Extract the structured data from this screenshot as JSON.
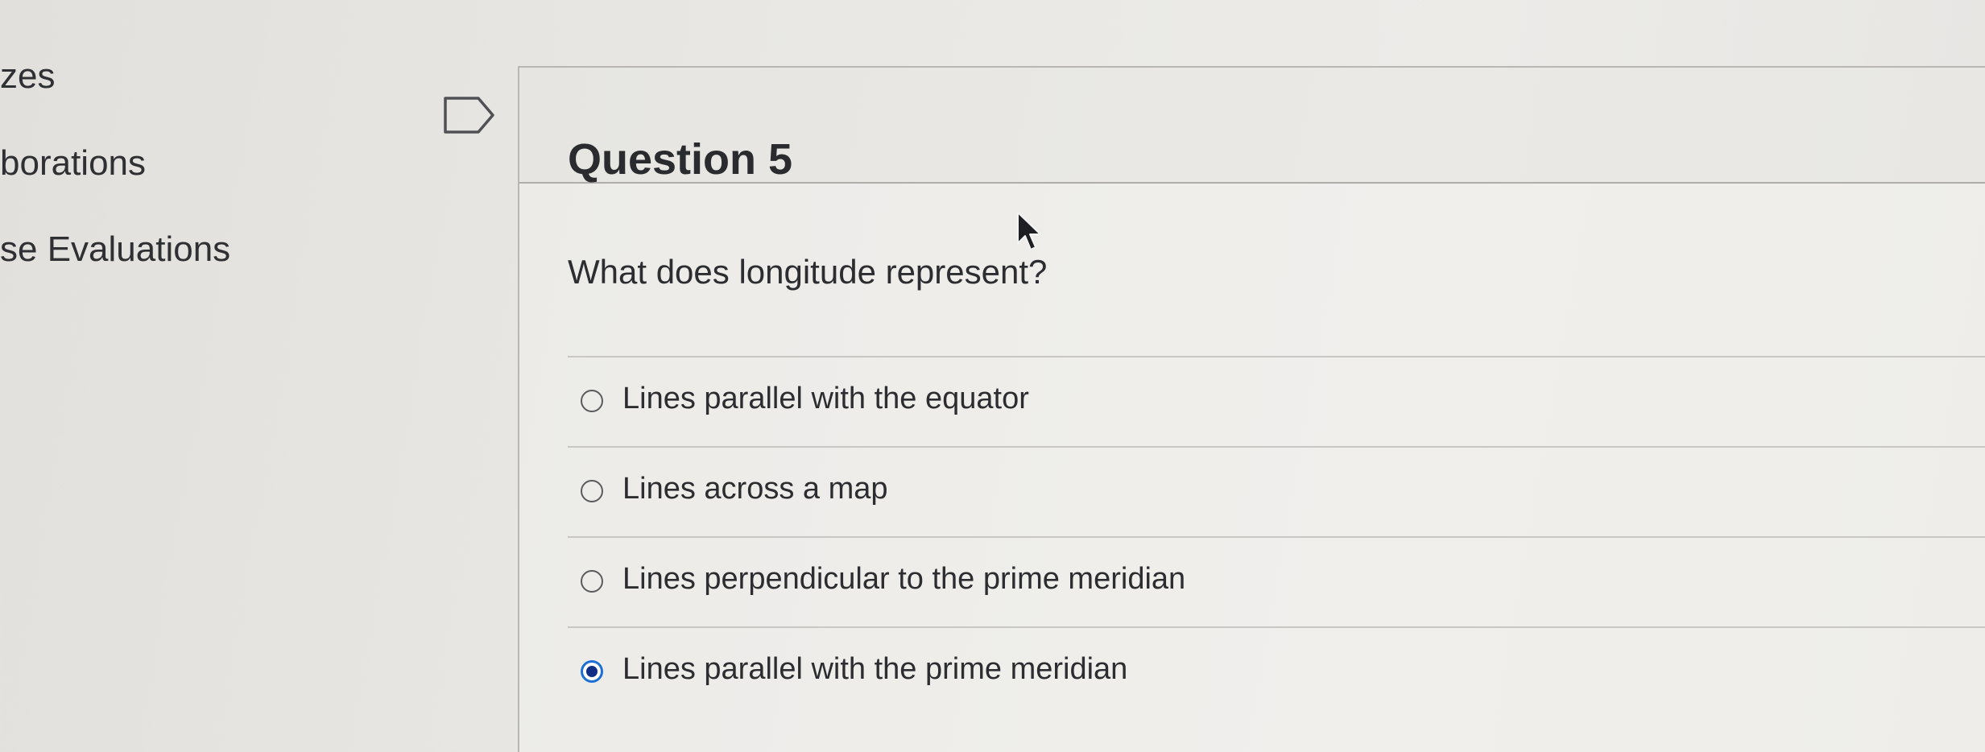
{
  "course_nav": {
    "items": [
      {
        "label": "zes"
      },
      {
        "label": "borations"
      },
      {
        "label": "se Evaluations"
      }
    ]
  },
  "question": {
    "title": "Question 5",
    "prompt": "What does longitude represent?",
    "answers": [
      {
        "label": "Lines parallel with the equator",
        "selected": false
      },
      {
        "label": "Lines across a map",
        "selected": false
      },
      {
        "label": "Lines perpendicular to the prime meridian",
        "selected": false
      },
      {
        "label": "Lines parallel with the prime meridian",
        "selected": true
      }
    ]
  },
  "icons": {
    "flag": "flag-outline-icon",
    "radio": "radio-button-icon",
    "cursor": "mouse-pointer-icon"
  },
  "colors": {
    "radio_selected_ring": "#1b6fd6",
    "radio_selected_dot": "#0f2f86",
    "text": "#2c2d30",
    "divider": "#c8c7c3"
  }
}
